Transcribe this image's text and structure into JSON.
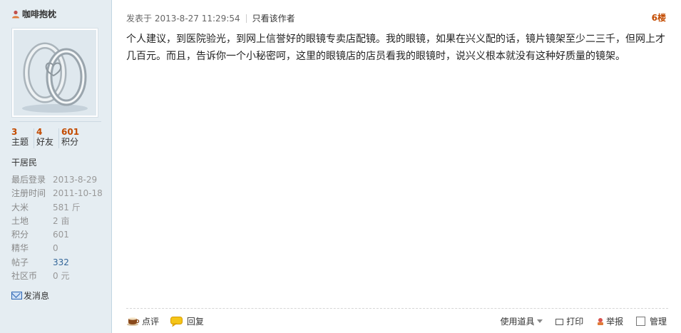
{
  "sidebar": {
    "username": "咖啡抱枕",
    "stats": [
      {
        "value": "3",
        "label": "主题"
      },
      {
        "value": "4",
        "label": "好友"
      },
      {
        "value": "601",
        "label": "积分"
      }
    ],
    "rank": "干居民",
    "info": [
      {
        "key": "最后登录",
        "value": "2013-8-29"
      },
      {
        "key": "注册时间",
        "value": "2011-10-18"
      },
      {
        "key": "大米",
        "value": "581 斤"
      },
      {
        "key": "土地",
        "value": "2 亩"
      },
      {
        "key": "积分",
        "value": "601"
      },
      {
        "key": "精华",
        "value": "0"
      },
      {
        "key": "帖子",
        "value": "332"
      },
      {
        "key": "社区币",
        "value": "0 元"
      }
    ],
    "send_message": "发消息"
  },
  "post": {
    "posted_at": "发表于 2013-8-27 11:29:54",
    "author_only": "只看该作者",
    "floor": "6楼",
    "content": "个人建议，到医院验光，到网上信誉好的眼镜专卖店配镜。我的眼镜，如果在兴义配的话，镜片镜架至少二三千，但网上才几百元。而且，告诉你一个小秘密呵，这里的眼镜店的店员看我的眼镜时，说兴义根本就没有这种好质量的镜架。"
  },
  "actions": {
    "comment": "点评",
    "reply": "回复",
    "use_tool": "使用道具",
    "print": "打印",
    "report": "举报",
    "manage": "管理"
  },
  "colors": {
    "sidebar_bg": "#e5edf2",
    "accent": "#c34b00",
    "link": "#336699"
  }
}
